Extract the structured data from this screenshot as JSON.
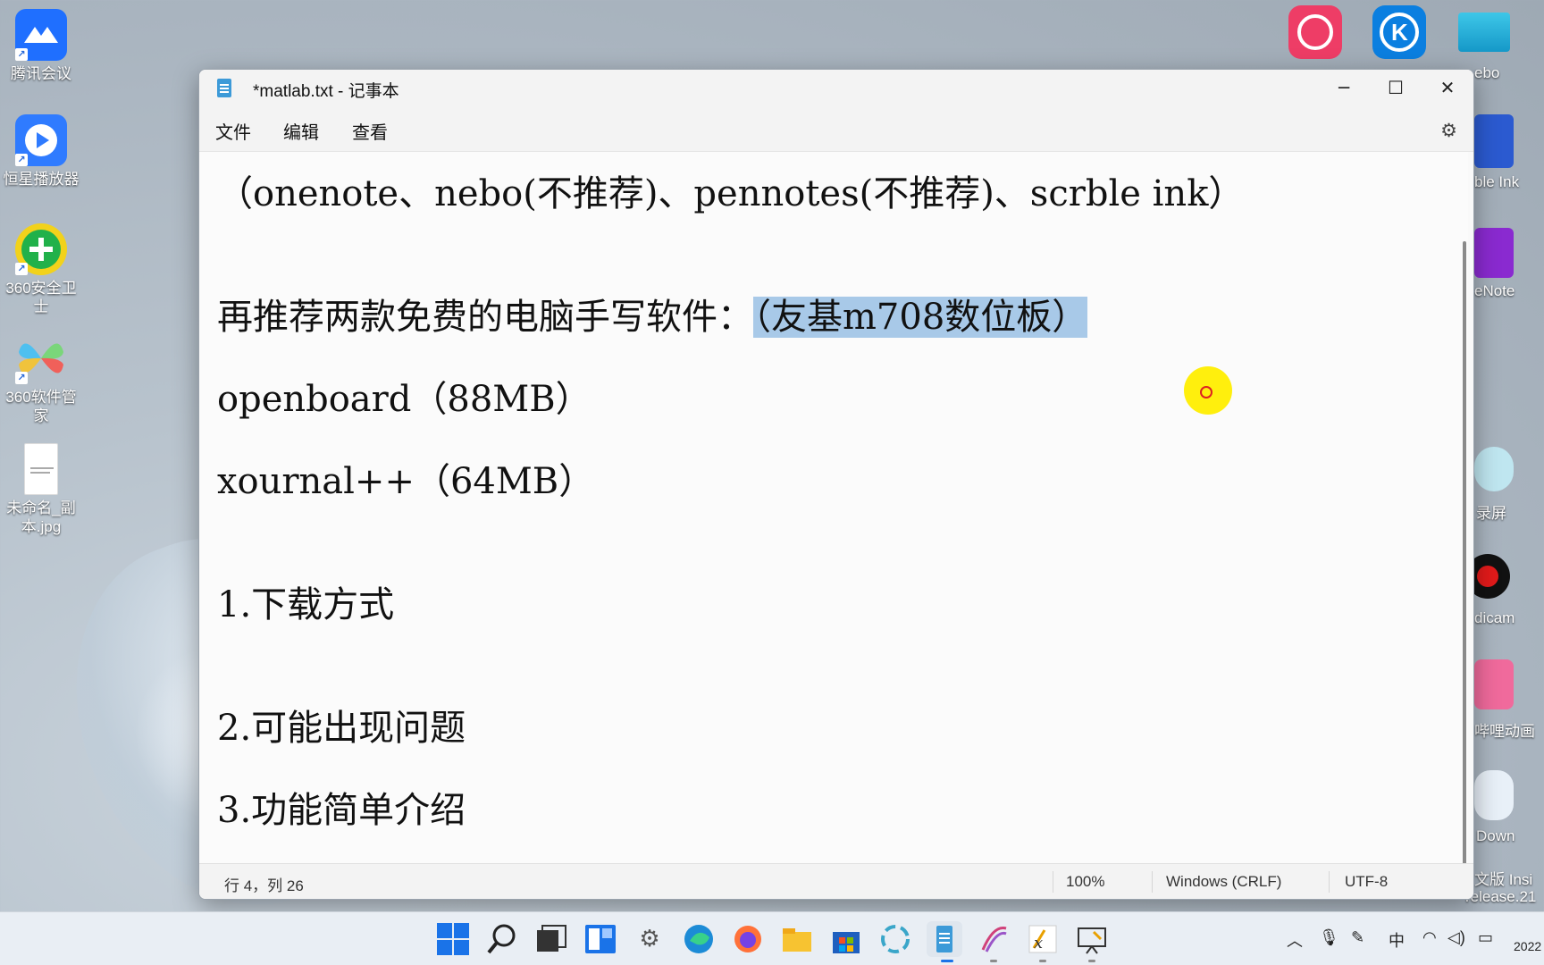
{
  "desktop": {
    "left_icons": [
      {
        "label": "腾讯会议",
        "color": "#1f6fff"
      },
      {
        "label": "恒星播放器",
        "color": "#2f7bff"
      },
      {
        "label": "360安全卫士",
        "color": "#21b14a"
      },
      {
        "label": "360软件管家",
        "color": "#4ec0f0"
      },
      {
        "label": "未命名_副本.jpg",
        "color": "#ffffff"
      }
    ],
    "right_labels": [
      "ebo",
      "ble Ink",
      "eNote",
      "录屏",
      "dicam",
      "哔哩动画",
      "Down",
      "文版 Insi",
      "release.21"
    ]
  },
  "window": {
    "title": "*matlab.txt - 记事本",
    "controls": {
      "minimize": "─",
      "maximize": "☐",
      "close": "✕"
    },
    "menu": [
      "文件",
      "编辑",
      "查看"
    ],
    "lines": [
      "（onenote、nebo(不推荐)、pennotes(不推荐)、scrble ink）",
      "再推荐两款免费的电脑手写软件：",
      "（友基m708数位板）",
      "openboard（88MB）",
      "xournal++（64MB）",
      "1.下载方式",
      "2.可能出现问题",
      "3.功能简单介绍"
    ],
    "status": {
      "position": "行 4，列 26",
      "zoom": "100%",
      "line_ending": "Windows (CRLF)",
      "encoding": "UTF-8"
    }
  },
  "taskbar": {
    "tray_ime": "中",
    "tray_date": "2022"
  }
}
